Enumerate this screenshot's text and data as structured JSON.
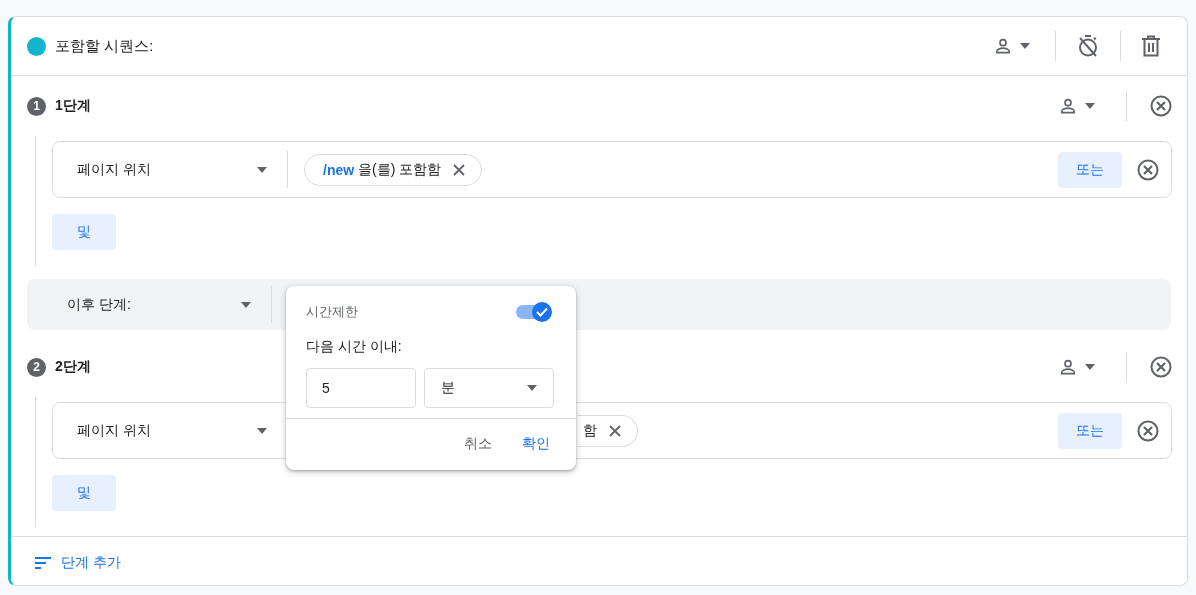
{
  "sequence": {
    "title": "포함할 시퀀스:",
    "color": "#12b5cb"
  },
  "steps": [
    {
      "number": "1",
      "title": "1단계",
      "condition": {
        "dimension": "페이지 위치",
        "chips": [
          {
            "value": "/new",
            "text": "을(를) 포함함"
          }
        ],
        "or_button": "또는"
      },
      "and_button": "및"
    },
    {
      "number": "2",
      "title": "2단계",
      "condition": {
        "dimension": "페이지 위치",
        "chips": [
          {
            "text": "함"
          }
        ],
        "or_button": "또는"
      },
      "and_button": "및"
    }
  ],
  "followed_by": {
    "label": "이후 단계:"
  },
  "time_popup": {
    "title": "시간제한",
    "toggle_on": true,
    "prompt": "다음 시간 이내:",
    "amount": "5",
    "unit": "분",
    "cancel": "취소",
    "ok": "확인"
  },
  "add_step": "단계 추가"
}
